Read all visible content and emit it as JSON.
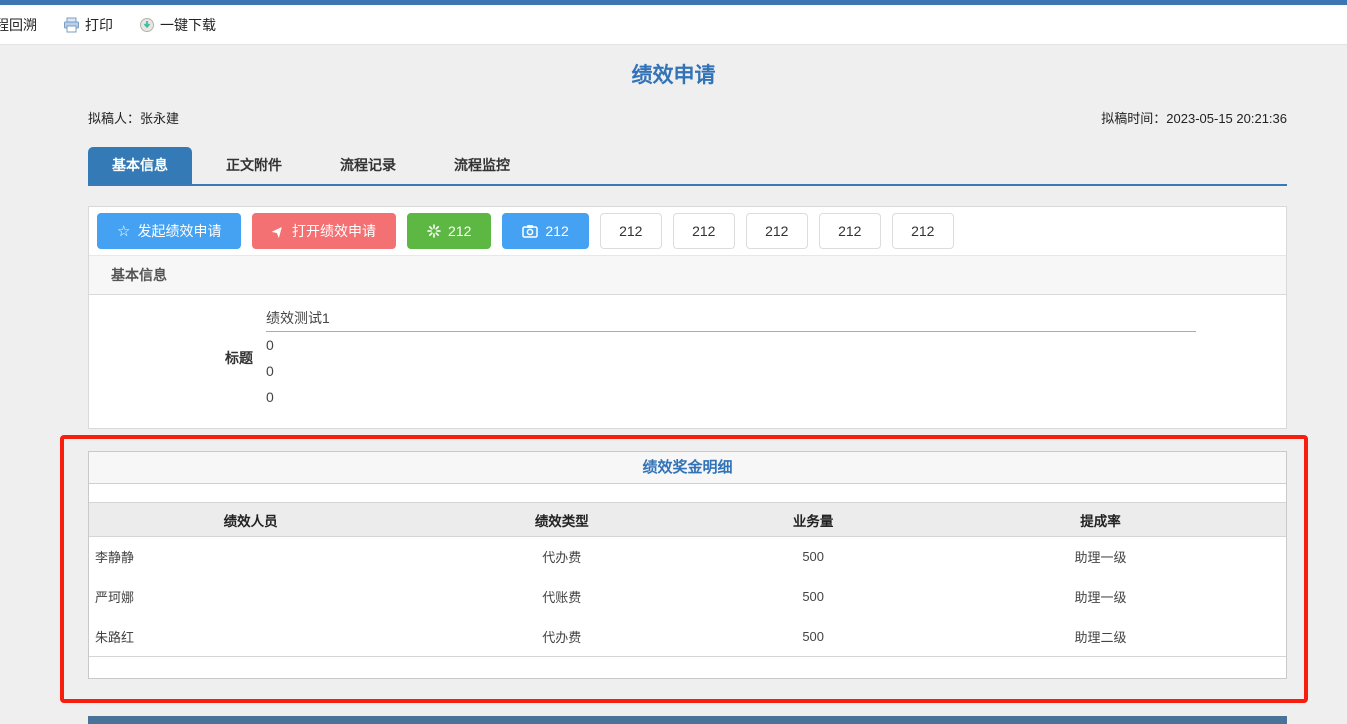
{
  "toolbar": {
    "items": [
      {
        "label": "程回溯",
        "icon": "trace-icon"
      },
      {
        "label": "打印",
        "icon": "printer-icon"
      },
      {
        "label": "一键下载",
        "icon": "download-icon"
      }
    ]
  },
  "page": {
    "title": "绩效申请",
    "drafter_label": "拟稿人：",
    "drafter_name": "张永建",
    "draft_time_label": "拟稿时间：",
    "draft_time": "2023-05-15 20:21:36"
  },
  "tabs": [
    {
      "label": "基本信息",
      "active": true
    },
    {
      "label": "正文附件",
      "active": false
    },
    {
      "label": "流程记录",
      "active": false
    },
    {
      "label": "流程监控",
      "active": false
    }
  ],
  "actions": {
    "primary": [
      {
        "label": "发起绩效申请",
        "icon": "star-icon",
        "color": "#45a2f3"
      },
      {
        "label": "打开绩效申请",
        "icon": "send-icon",
        "color": "#f47173"
      },
      {
        "label": "212",
        "icon": "spinner-icon",
        "color": "#5cb842"
      },
      {
        "label": "212",
        "icon": "camera-icon",
        "color": "#45a2f3"
      }
    ],
    "secondary": [
      "212",
      "212",
      "212",
      "212",
      "212"
    ]
  },
  "basic_info": {
    "section_title": "基本信息",
    "title_label": "标题",
    "title_values": [
      "绩效测试1",
      "0",
      "0",
      "0"
    ]
  },
  "bonus_detail": {
    "section_title": "绩效奖金明细",
    "table": {
      "headers": [
        "绩效人员",
        "绩效类型",
        "业务量",
        "提成率"
      ],
      "rows": [
        [
          "李静静",
          "代办费",
          "500",
          "助理一级"
        ],
        [
          "严珂娜",
          "代账费",
          "500",
          "助理一级"
        ],
        [
          "朱路红",
          "代办费",
          "500",
          "助理二级"
        ]
      ]
    }
  },
  "colors": {
    "top_strip": "#3d76b3",
    "title_blue": "#3273b8",
    "active_tab": "#337ab7",
    "tab_underline": "#3a78b8",
    "button_blue": "#45a2f3",
    "button_red": "#f47173",
    "button_green": "#5cb842",
    "highlight_border_red": "#f81d0d",
    "section_header_blue": "#3273b8",
    "next_section_bar": "#4a7398"
  }
}
